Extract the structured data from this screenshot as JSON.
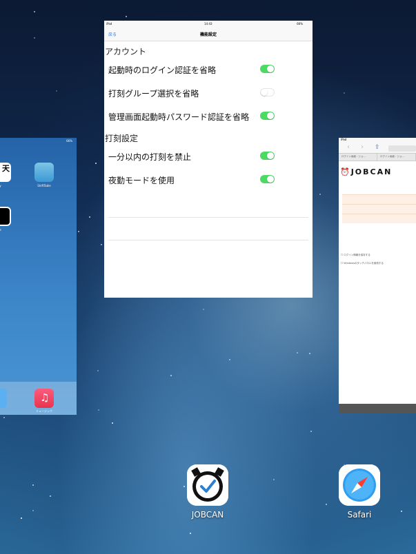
{
  "center_card": {
    "status": {
      "device": "iPad",
      "time": "14:43",
      "battery": "66%"
    },
    "nav": {
      "back": "戻る",
      "title": "機能設定"
    },
    "sections": [
      {
        "header": "アカウント",
        "rows": [
          {
            "label": "起動時のログイン認証を省略",
            "on": true
          },
          {
            "label": "打刻グループ選択を省略",
            "on": false
          },
          {
            "label": "管理画面起動時パスワード認証を省略",
            "on": true
          }
        ]
      },
      {
        "header": "打刻設定",
        "rows": [
          {
            "label": "一分以内の打刻を禁止",
            "on": true
          },
          {
            "label": "夜勤モードを使用",
            "on": true
          }
        ]
      }
    ]
  },
  "left_card": {
    "status": "66%",
    "apps": [
      {
        "label": "ly",
        "glyph": "天"
      },
      {
        "label": "ShiftTable"
      },
      {
        "label": "ts"
      },
      {
        "label": "ミュージック"
      }
    ]
  },
  "right_card": {
    "status": "iPad",
    "tabs": [
      "ログイン画面 : ジョ...",
      "ログイン画面 : ジョ..."
    ],
    "logo": "JOBCAN",
    "checks": [
      "ログイン情報を保存する",
      "Windowsのタッチパネルを使用する"
    ]
  },
  "apps": [
    {
      "name": "JOBCAN"
    },
    {
      "name": "Safari"
    }
  ],
  "colors": {
    "toggle_on": "#4cd964",
    "link": "#1f7cf5"
  }
}
